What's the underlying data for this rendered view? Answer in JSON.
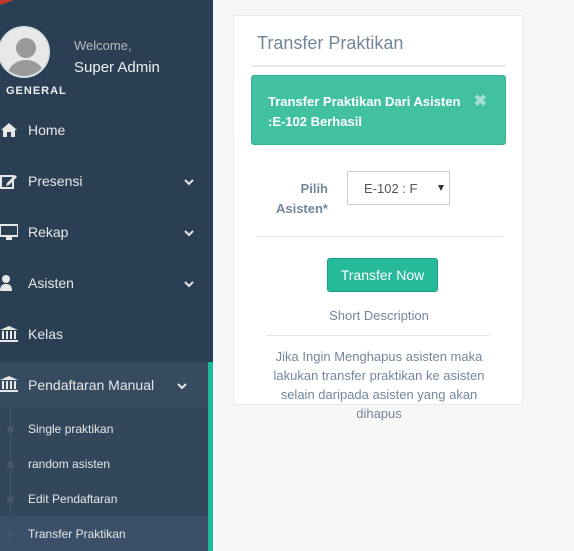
{
  "sidebar": {
    "profile": {
      "welcome": "Welcome,",
      "name": "Super Admin",
      "role": "GENERAL"
    },
    "menu": [
      {
        "label": "Home",
        "icon": "home-icon"
      },
      {
        "label": "Presensi",
        "icon": "edit-icon"
      },
      {
        "label": "Rekap",
        "icon": "desktop-icon"
      },
      {
        "label": "Asisten",
        "icon": "user-icon"
      },
      {
        "label": "Kelas",
        "icon": "bank-icon"
      },
      {
        "label": "Pendaftaran Manual",
        "icon": "bank-icon"
      }
    ],
    "submenu": [
      {
        "label": "Single praktikan"
      },
      {
        "label": "random asisten"
      },
      {
        "label": "Edit Pendaftaran"
      },
      {
        "label": "Transfer Praktikan"
      }
    ]
  },
  "panel": {
    "title": "Transfer Praktikan",
    "alert": {
      "message": "Transfer Praktikan Dari Asisten :E-102 Berhasil",
      "close": "✖"
    },
    "field": {
      "label": "Pilih Asisten*",
      "selected": "E-102 : F"
    },
    "button": "Transfer Now",
    "short_description": "Short Description",
    "description": "Jika Ingin Menghapus asisten maka lakukan transfer praktikan ke asisten selain daripada asisten yang akan dihapus"
  },
  "colors": {
    "sidebar_bg": "#2a3f54",
    "accent": "#1ABB9C",
    "alert_bg": "#42c1a1",
    "button_bg": "#26B99A"
  }
}
